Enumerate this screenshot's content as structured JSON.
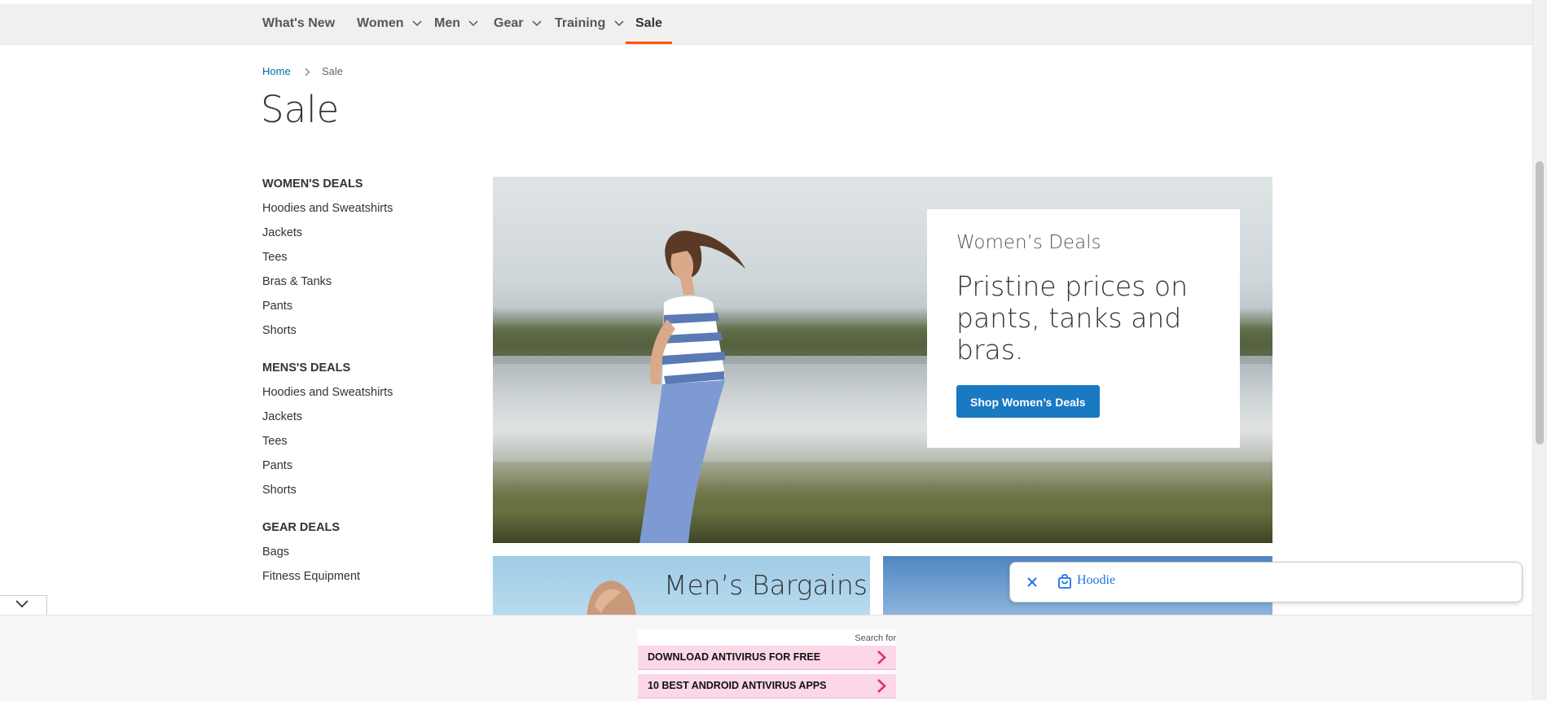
{
  "nav": {
    "items": [
      {
        "label": "What's New",
        "has_dropdown": false
      },
      {
        "label": "Women",
        "has_dropdown": true
      },
      {
        "label": "Men",
        "has_dropdown": true
      },
      {
        "label": "Gear",
        "has_dropdown": true
      },
      {
        "label": "Training",
        "has_dropdown": true
      },
      {
        "label": "Sale",
        "has_dropdown": false,
        "active": true
      }
    ],
    "active_color": "#ff5501"
  },
  "breadcrumb": {
    "home": "Home",
    "current": "Sale"
  },
  "page_title": "Sale",
  "sidebar": {
    "groups": [
      {
        "heading": "WOMEN'S DEALS",
        "links": [
          "Hoodies and Sweatshirts",
          "Jackets",
          "Tees",
          "Bras & Tanks",
          "Pants",
          "Shorts"
        ]
      },
      {
        "heading": "MENS'S DEALS",
        "links": [
          "Hoodies and Sweatshirts",
          "Jackets",
          "Tees",
          "Pants",
          "Shorts"
        ]
      },
      {
        "heading": "GEAR DEALS",
        "links": [
          "Bags",
          "Fitness Equipment"
        ]
      }
    ]
  },
  "hero": {
    "kicker": "Women’s Deals",
    "headline": "Pristine prices on pants, tanks and bras.",
    "cta": "Shop Women’s Deals",
    "cta_color": "#1979c3"
  },
  "tiles": {
    "mens_title": "Men’s Bargains"
  },
  "chip": {
    "text": "Hoodie"
  },
  "ads": {
    "search_for": "Search for",
    "links": [
      "DOWNLOAD ANTIVIRUS FOR FREE",
      "10 BEST ANDROID ANTIVIRUS APPS"
    ]
  }
}
